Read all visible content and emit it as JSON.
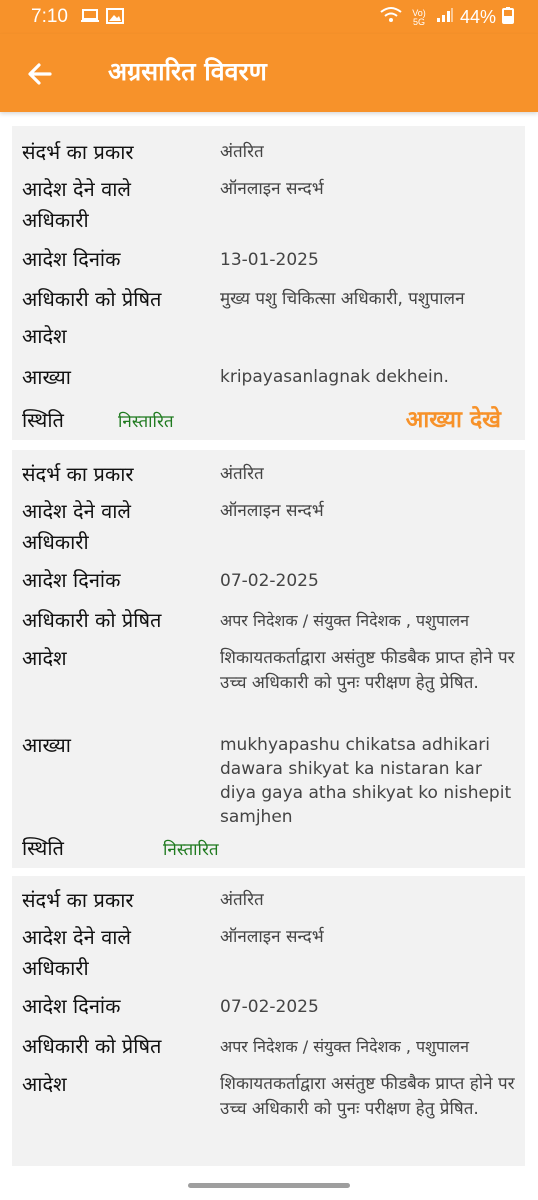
{
  "status_bar": {
    "time": "7:10",
    "net": "Vo) 5G",
    "battery": "44%"
  },
  "header": {
    "title": "अग्रसारित विवरण"
  },
  "labels": {
    "ref_type": "संदर्भ का प्रकार",
    "issuer_l1": "आदेश देने वाले",
    "issuer_l2": "अधिकारी",
    "order_date": "आदेश दिनांक",
    "sent_to_l1": "अधिकारी को प्रेषित",
    "sent_to_l2": "आदेश",
    "remark": "आख्या",
    "status": "स्थिति"
  },
  "records": [
    {
      "ref_type": "अंतरित",
      "issuer": "ऑनलाइन सन्दर्भ",
      "order_date": "13-01-2025",
      "sent_to": "मुख्य पशु चिकित्सा अधिकारी, पशुपालन",
      "remark": "kripayasanlagnak dekhein.",
      "status": "निस्तारित",
      "view_label": "आख्या देखे"
    },
    {
      "ref_type": "अंतरित",
      "issuer": "ऑनलाइन सन्दर्भ",
      "order_date": "07-02-2025",
      "sent_to": "अपर निदेशक / संयुक्त निदेशक , पशुपालन",
      "order": "शिकायतकर्ताद्वारा असंतुष्ट फीडबैक प्राप्त होने पर  उच्च अधिकारी को पुनः परीक्षण हेतु प्रेषित.",
      "remark": "mukhyapashu chikatsa adhikari dawara shikyat ka nistaran kar diya gaya atha shikyat ko nishepit samjhen",
      "status": "निस्तारित"
    },
    {
      "ref_type": "अंतरित",
      "issuer": "ऑनलाइन सन्दर्भ",
      "order_date": "07-02-2025",
      "sent_to": "अपर निदेशक / संयुक्त निदेशक , पशुपालन",
      "order": "शिकायतकर्ताद्वारा असंतुष्ट फीडबैक प्राप्त होने पर  उच्च अधिकारी को पुनः परीक्षण हेतु प्रेषित."
    }
  ]
}
